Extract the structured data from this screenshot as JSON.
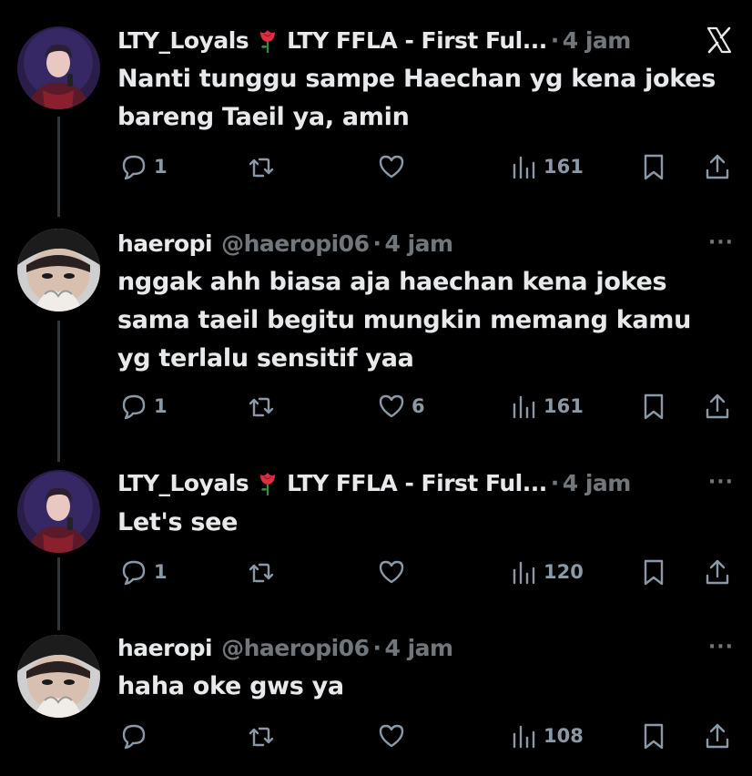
{
  "tweets": [
    {
      "name": "LTY_Loyals",
      "name_suffix": "LTY FFLA - First Ful...",
      "handle": "",
      "time": "4 jam",
      "text_lines": [
        "Nanti tunggu sampe Haechan yg kena jokes",
        "bareng Taeil ya, amin"
      ],
      "replies": "1",
      "retweets": "",
      "likes": "",
      "views": "161",
      "top_right_icon": "x-logo-icon"
    },
    {
      "name": "haeropi",
      "name_suffix": "",
      "handle": "@haeropi06",
      "time": "4 jam",
      "text_lines": [
        "nggak ahh biasa aja haechan kena jokes",
        "sama taeil begitu mungkin memang kamu",
        "yg terlalu sensitif yaa"
      ],
      "replies": "1",
      "retweets": "",
      "likes": "6",
      "views": "161",
      "top_right_icon": "more-icon"
    },
    {
      "name": "LTY_Loyals",
      "name_suffix": "LTY FFLA - First Ful...",
      "handle": "",
      "time": "4 jam",
      "text_lines": [
        "Let's see"
      ],
      "replies": "1",
      "retweets": "",
      "likes": "",
      "views": "120",
      "top_right_icon": "more-icon"
    },
    {
      "name": "haeropi",
      "name_suffix": "",
      "handle": "@haeropi06",
      "time": "4 jam",
      "text_lines": [
        "haha oke gws ya"
      ],
      "replies": "",
      "retweets": "",
      "likes": "",
      "views": "108",
      "top_right_icon": "more-icon"
    }
  ],
  "ui": {
    "dot": "·",
    "more": "···"
  },
  "colors": {
    "background": "#000000",
    "text": "#e7e9ea",
    "muted": "#71767b",
    "icon": "#8b98a5",
    "thread_line": "#333639",
    "rose": "#e0245e"
  }
}
